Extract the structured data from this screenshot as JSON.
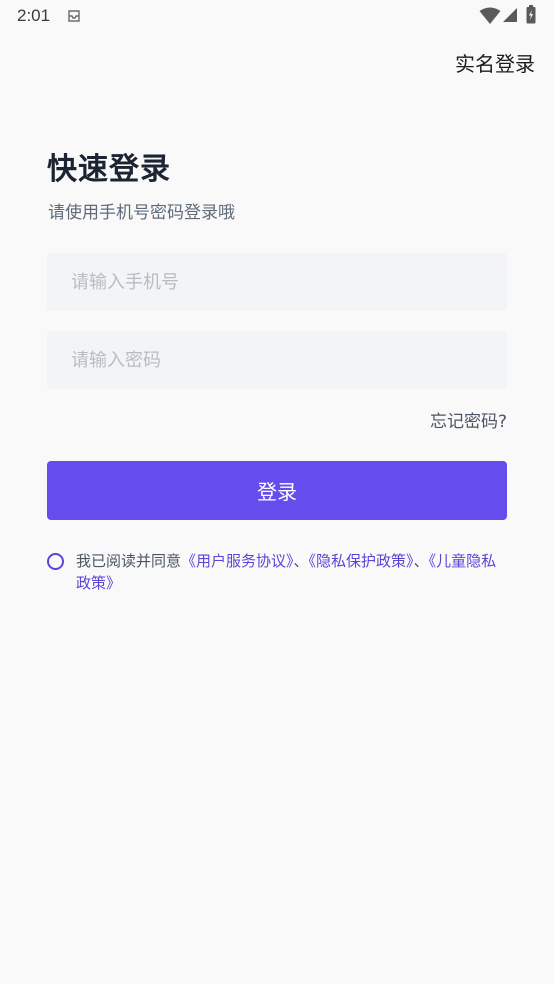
{
  "status_bar": {
    "time": "2:01"
  },
  "header": {
    "realname_login": "实名登录"
  },
  "main": {
    "title": "快速登录",
    "subtitle": "请使用手机号密码登录哦",
    "phone_placeholder": "请输入手机号",
    "password_placeholder": "请输入密码",
    "forgot_password": "忘记密码?",
    "login_label": "登录"
  },
  "agreement": {
    "prefix": "我已阅读并同意",
    "user_agreement": "《用户服务协议》",
    "sep1": "、",
    "privacy_policy": "《隐私保护政策》",
    "sep2": "、",
    "child_privacy": "《儿童隐私政策》"
  },
  "colors": {
    "accent": "#654ded",
    "link": "#5b45d6",
    "background": "#f9f9fa",
    "input_bg": "#f3f4f6"
  }
}
